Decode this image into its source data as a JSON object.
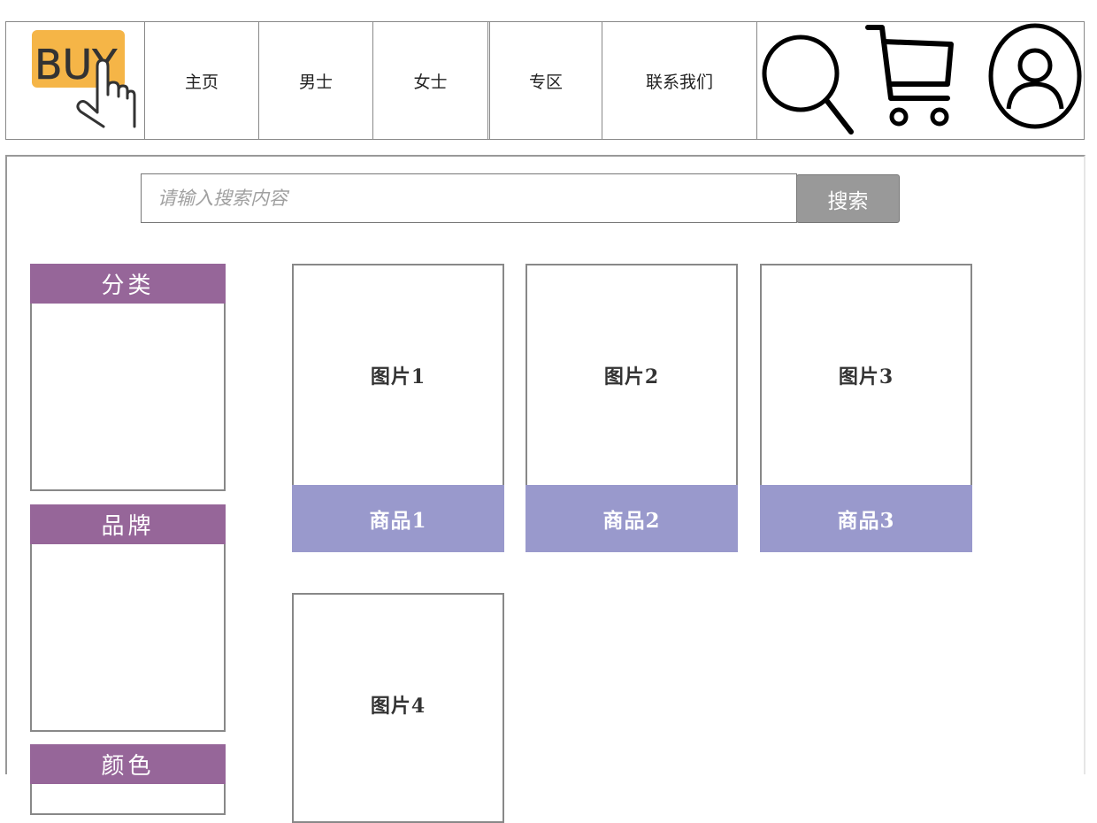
{
  "header": {
    "logo_text": "BUY",
    "nav": [
      "主页",
      "男士",
      "女士",
      "专区",
      "联系我们"
    ],
    "icons": [
      "search-icon",
      "cart-icon",
      "user-icon"
    ]
  },
  "search": {
    "placeholder": "请输入搜索内容",
    "button_label": "搜索"
  },
  "filters": [
    "分类",
    "品牌",
    "颜色"
  ],
  "products": [
    {
      "image": "图片1",
      "name": "商品1"
    },
    {
      "image": "图片2",
      "name": "商品2"
    },
    {
      "image": "图片3",
      "name": "商品3"
    },
    {
      "image": "图片4",
      "name": ""
    }
  ],
  "colors": {
    "logo_bg": "#f5b547",
    "filter_head": "#966699",
    "product_name_bg": "#9999cc",
    "search_button": "#999999"
  }
}
